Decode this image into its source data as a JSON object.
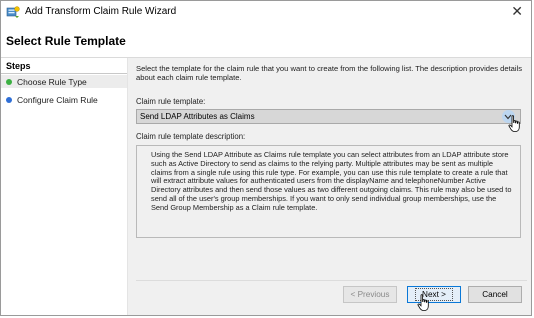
{
  "window": {
    "title": "Add Transform Claim Rule Wizard",
    "close_glyph": "✕"
  },
  "header": {
    "heading": "Select Rule Template"
  },
  "steps": {
    "heading": "Steps",
    "items": [
      {
        "label": "Choose Rule Type",
        "status_color": "#3cb043",
        "active": true
      },
      {
        "label": "Configure Claim Rule",
        "status_color": "#2f6fd6",
        "active": false
      }
    ]
  },
  "main": {
    "intro": "Select the template for the claim rule that you want to create from the following list. The description provides details about each claim rule template.",
    "template_label": "Claim rule template:",
    "template_selected": "Send LDAP Attributes as Claims",
    "description_label": "Claim rule template description:",
    "description": "Using the Send LDAP Attribute as Claims rule template you can select attributes from an LDAP attribute store such as Active Directory to send as claims to the relying party. Multiple attributes may be sent as multiple claims from a single rule using this rule type. For example, you can use this rule template to create a rule that will extract attribute values for authenticated users from the displayName and telephoneNumber Active Directory attributes and then send those values as two different outgoing claims. This rule may also be used to send all of the user's group memberships. If you want to only send individual group memberships, use the Send Group Membership as a Claim rule template."
  },
  "buttons": {
    "previous": "< Previous",
    "next": "Next >",
    "cancel": "Cancel"
  },
  "icons": {
    "title_icon": "wizard-icon",
    "dropdown": "chevron-down-icon",
    "cursor": "hand-pointer-icon"
  }
}
